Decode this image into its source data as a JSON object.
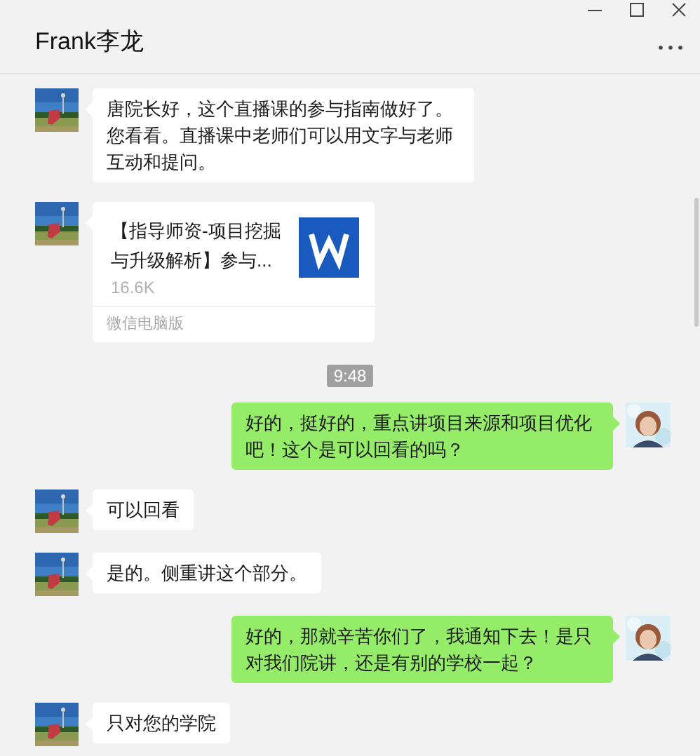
{
  "window": {
    "title": "Frank李龙"
  },
  "messages": [
    {
      "kind": "text",
      "sent": false,
      "text": "唐院长好，这个直播课的参与指南做好了。您看看。直播课中老师们可以用文字与老师互动和提问。"
    },
    {
      "kind": "file",
      "sent": false,
      "file_name": "【指导师资-项目挖掘与升级解析】参与...",
      "size": "16.6K",
      "source": "微信电脑版"
    },
    {
      "kind": "time",
      "text": "9:48"
    },
    {
      "kind": "text",
      "sent": true,
      "text": "好的，挺好的，重点讲项目来源和项目优化吧！这个是可以回看的吗？"
    },
    {
      "kind": "text",
      "sent": false,
      "text": "可以回看"
    },
    {
      "kind": "text",
      "sent": false,
      "text": "是的。侧重讲这个部分。"
    },
    {
      "kind": "text",
      "sent": true,
      "text": "好的，那就辛苦你们了，我通知下去！是只对我们院讲，还是有别的学校一起？"
    },
    {
      "kind": "text",
      "sent": false,
      "text": "只对您的学院"
    }
  ]
}
